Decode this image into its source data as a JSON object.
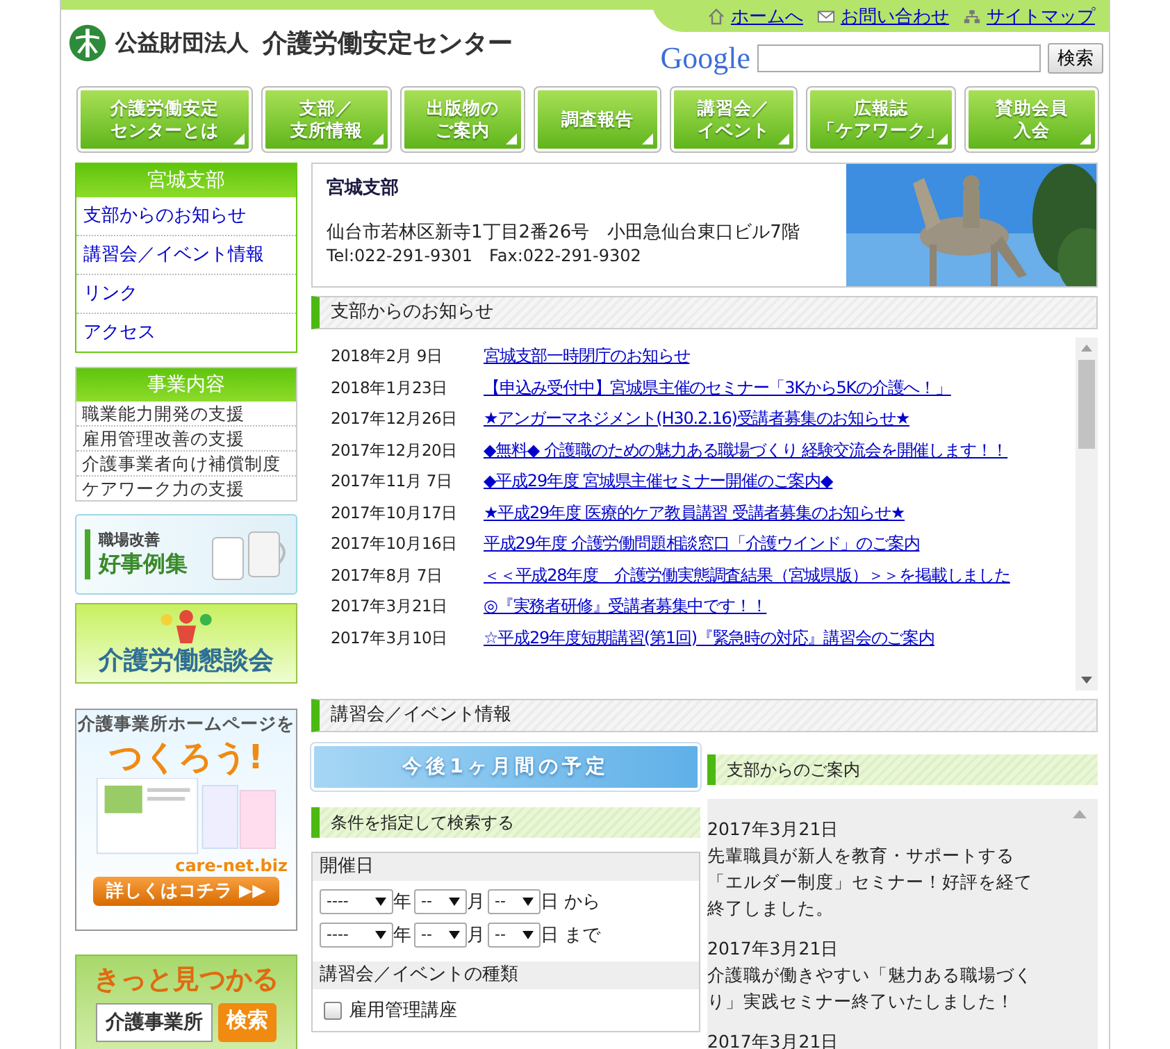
{
  "header": {
    "org_prefix": "公益財団法人",
    "org_name": "介護労働安定センター",
    "links": [
      {
        "label": "ホームへ"
      },
      {
        "label": "お問い合わせ"
      },
      {
        "label": "サイトマップ"
      }
    ],
    "search": {
      "logo": "Google",
      "button": "検索"
    }
  },
  "nav": [
    {
      "lines": [
        "介護労働安定",
        "センターとは"
      ]
    },
    {
      "lines": [
        "支部／",
        "支所情報"
      ]
    },
    {
      "lines": [
        "出版物の",
        "ご案内"
      ]
    },
    {
      "lines": [
        "調査報告"
      ]
    },
    {
      "lines": [
        "講習会／",
        "イベント"
      ]
    },
    {
      "lines": [
        "広報誌",
        "「ケアワーク」"
      ]
    },
    {
      "lines": [
        "賛助会員",
        "入会"
      ]
    }
  ],
  "sidebar": {
    "branch_menu": {
      "title": "宮城支部",
      "items": [
        "支部からのお知らせ",
        "講習会／イベント情報",
        "リンク",
        "アクセス"
      ]
    },
    "business": {
      "title": "事業内容",
      "items": [
        "職業能力開発の支援",
        "雇用管理改善の支援",
        "介護事業者向け補償制度",
        "ケアワーク力の支援"
      ]
    },
    "banners": [
      {
        "kind": "cases",
        "label": "職場改善",
        "title": "好事例集"
      },
      {
        "kind": "forum",
        "title": "介護労働懇談会"
      },
      {
        "kind": "homepage",
        "lead": "介護事業所ホームページを",
        "title": "つくろう!",
        "site": "care-net.biz",
        "button": "詳しくはコチラ ▶▶"
      },
      {
        "kind": "finder",
        "title": "きっと見つかる",
        "field": "介護事業所",
        "button": "検索"
      }
    ]
  },
  "branch_info": {
    "name": "宮城支部",
    "address": "仙台市若林区新寺1丁目2番26号　小田急仙台東口ビル7階",
    "contact": "Tel:022-291-9301　Fax:022-291-9302"
  },
  "notices": {
    "title": "支部からのお知らせ",
    "items": [
      {
        "date": "2018年2月 9日",
        "title": "宮城支部一時閉庁のお知らせ"
      },
      {
        "date": "2018年1月23日",
        "title": "【申込み受付中】宮城県主催のセミナー「3Kから5Kの介護へ！」"
      },
      {
        "date": "2017年12月26日",
        "title": "★アンガーマネジメント(H30.2.16)受講者募集のお知らせ★"
      },
      {
        "date": "2017年12月20日",
        "title": "◆無料◆ 介護職のための魅力ある職場づくり 経験交流会を開催します！！"
      },
      {
        "date": "2017年11月 7日",
        "title": "◆平成29年度 宮城県主催セミナー開催のご案内◆"
      },
      {
        "date": "2017年10月17日",
        "title": "★平成29年度 医療的ケア教員講習 受講者募集のお知らせ★"
      },
      {
        "date": "2017年10月16日",
        "title": "平成29年度 介護労働問題相談窓口「介護ウインド」のご案内"
      },
      {
        "date": "2017年8月 7日",
        "title": "＜＜平成28年度　介護労働実態調査結果（宮城県版）＞＞を掲載しました"
      },
      {
        "date": "2017年3月21日",
        "title": "◎『実務者研修』受講者募集中です！！"
      },
      {
        "date": "2017年3月10日",
        "title": "☆平成29年度短期講習(第1回)『緊急時の対応』講習会のご案内"
      }
    ]
  },
  "events": {
    "title": "講習会／イベント情報",
    "schedule_button": "今後1ヶ月間の予定",
    "search": {
      "title": "条件を指定して検索する",
      "date_label": "開催日",
      "ranges": [
        {
          "fields": [
            {
              "value": "----",
              "unit": "年"
            },
            {
              "value": "--",
              "unit": "月"
            },
            {
              "value": "--",
              "unit": "日 から"
            }
          ]
        },
        {
          "fields": [
            {
              "value": "----",
              "unit": "年"
            },
            {
              "value": "--",
              "unit": "月"
            },
            {
              "value": "--",
              "unit": "日 まで"
            }
          ]
        }
      ],
      "type_label": "講習会／イベントの種類",
      "types": [
        {
          "label": "雇用管理講座",
          "checked": false
        }
      ]
    }
  },
  "guide": {
    "title": "支部からのご案内",
    "items": [
      {
        "date": "2017年3月21日",
        "text": "先輩職員が新人を教育・サポートする「エルダー制度」セミナー！好評を経て終了しました。"
      },
      {
        "date": "2017年3月21日",
        "text": "介護職が働きやすい「魅力ある職場づくり」実践セミナー終了いたしました！"
      },
      {
        "date": "2017年3月21日"
      }
    ]
  }
}
